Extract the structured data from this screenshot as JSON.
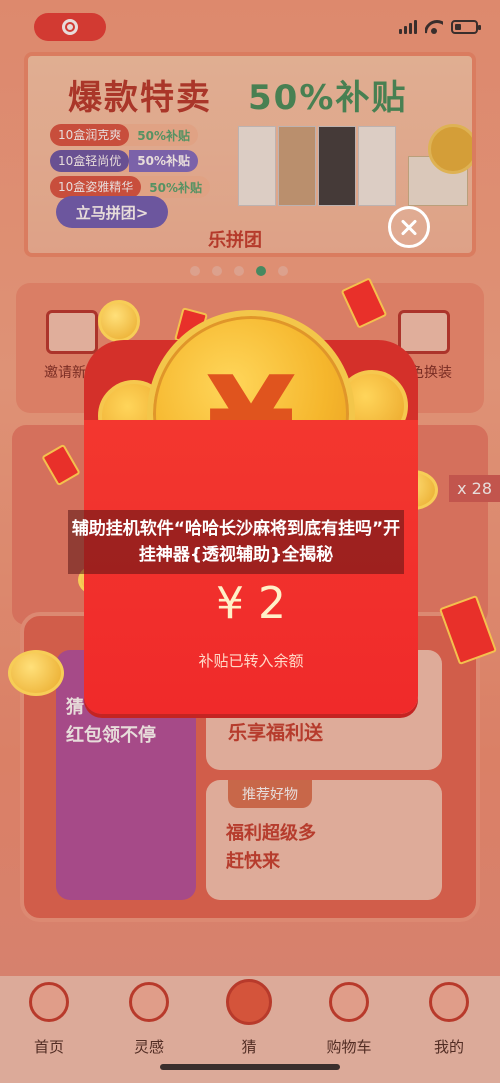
{
  "status_bar": {
    "icons": [
      "record-icon",
      "signal-icon",
      "wifi-icon",
      "battery-icon"
    ]
  },
  "banner": {
    "title_left": "爆款特卖",
    "title_right": "50%补贴",
    "promos": [
      {
        "name": "10盒润克爽",
        "tag": "50%补贴"
      },
      {
        "name": "10盒轻尚优",
        "tag": "50%补贴"
      },
      {
        "name": "10盒姿雅精华",
        "tag": "50%补贴"
      }
    ],
    "button": "立马拼团>",
    "brand": "乐拼团"
  },
  "grid": {
    "items": [
      {
        "label": "邀请新人"
      },
      {
        "label": "角色换装"
      }
    ]
  },
  "side_badge": "x 28",
  "tiles": {
    "tile1_line1": "猜",
    "tile1_line2": "红包领不停",
    "tile2_text": "乐享福利送",
    "tile3_tag": "推荐好物",
    "tile3_line1": "福利超级多",
    "tile3_line2": "赶快来"
  },
  "tabbar": {
    "tabs": [
      {
        "label": "首页"
      },
      {
        "label": "灵感"
      },
      {
        "label": "猜"
      },
      {
        "label": "购物车"
      },
      {
        "label": "我的"
      }
    ]
  },
  "modal": {
    "title": "辅助挂机软件“哈哈长沙麻将到底有挂吗”开挂神器{透视辅助}全揭秘",
    "coin_symbol": "¥",
    "amount": "¥ 2",
    "note": "补贴已转入余额"
  },
  "colors": {
    "envelope": "#f02a2a",
    "coin": "#f5b62c",
    "accent_green": "#3b9a6b"
  }
}
